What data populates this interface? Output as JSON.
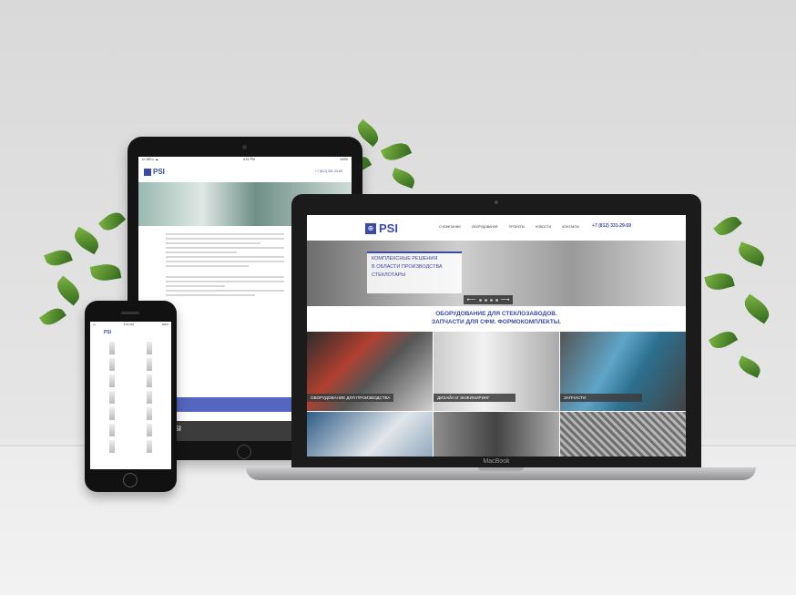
{
  "laptop": {
    "brand_label": "MacBook",
    "site": {
      "logo_mark": "⊕",
      "logo_text": "PSI",
      "menu": [
        "О компании",
        "Оборудование",
        "Проекты",
        "Новости",
        "Контакты"
      ],
      "phone": "+7 (812) 331-29-59",
      "hero_lines": [
        "КОМПЛЕКСНЫЕ РЕШЕНИЯ",
        "В ОБЛАСТИ ПРОИЗВОДСТВА",
        "СТЕКЛОТАРЫ"
      ],
      "slider_prev": "⟵",
      "slider_next": "⟶",
      "headline_lines": [
        "ОБОРУДОВАНИЕ ДЛЯ СТЕКЛОЗАВОДОВ.",
        "ЗАПЧАСТИ ДЛЯ СФМ. ФОРМОКОМПЛЕКТЫ."
      ],
      "tiles": [
        {
          "caption": "ОБОРУДОВАНИЕ ДЛЯ ПРОИЗВОДСТВА"
        },
        {
          "caption": "ДИЗАЙН И ЭНЖИНИРИНГ"
        },
        {
          "caption": "ЗАПЧАСТИ"
        }
      ]
    }
  },
  "tablet": {
    "status_left": "••• DELL ☁",
    "status_time": "4:21 PM",
    "status_right": "100%",
    "logo_text": "PSI",
    "phone": "+7 (812) 331-29-59",
    "footer_logo": "PSI"
  },
  "phone": {
    "status_left": "•••",
    "status_time": "4:21 PM",
    "status_right": "100%",
    "logo_text": "PSI"
  }
}
